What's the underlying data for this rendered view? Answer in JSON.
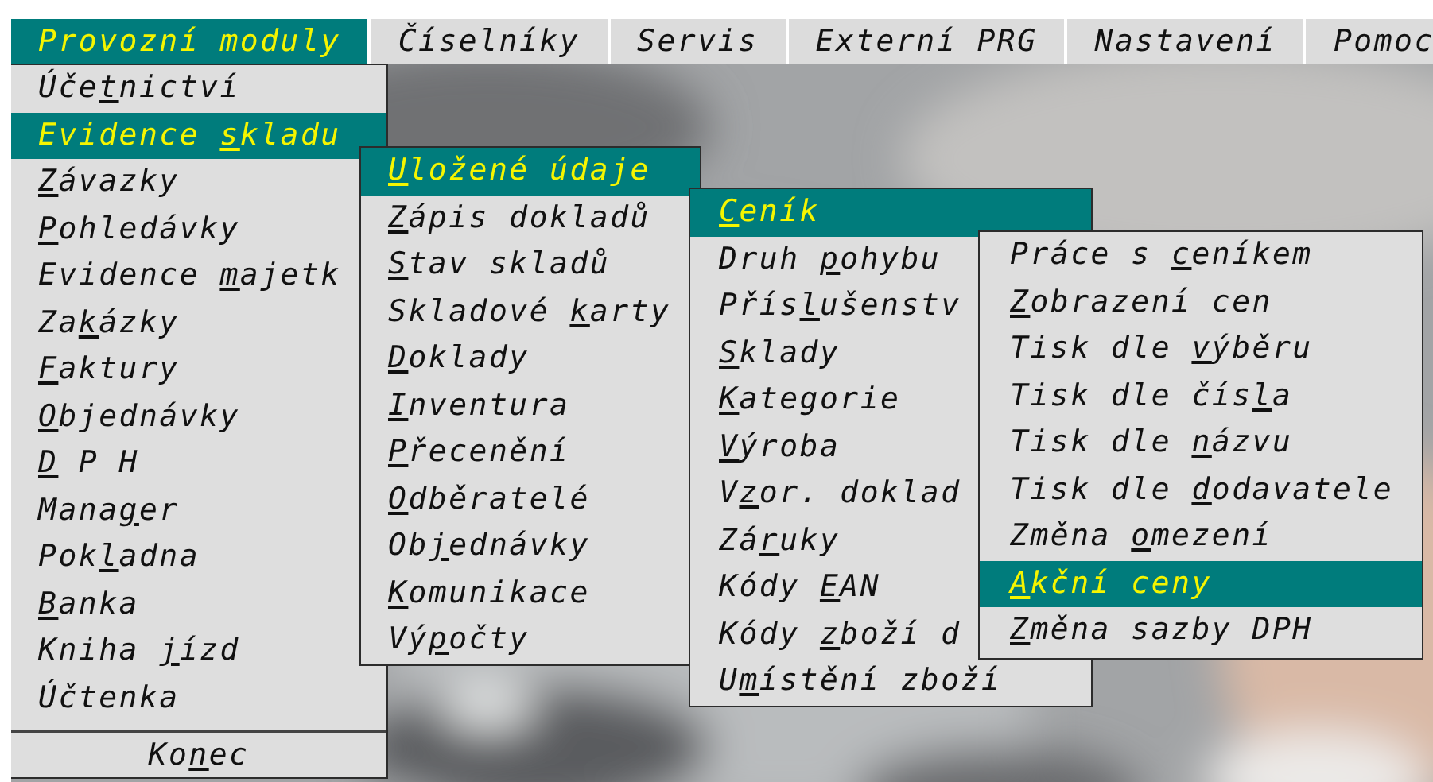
{
  "menubar": [
    {
      "label": "Provozní moduly",
      "selected": true
    },
    {
      "label": "Číselníky",
      "selected": false
    },
    {
      "label": "Servis",
      "selected": false
    },
    {
      "label": "Externí PRG",
      "selected": false
    },
    {
      "label": "Nastavení",
      "selected": false
    },
    {
      "label": "Pomoc",
      "selected": false
    }
  ],
  "menus": [
    {
      "items": [
        {
          "before": "Úče",
          "hotkey": "t",
          "after": "nictví",
          "selected": false
        },
        {
          "before": "Evidence ",
          "hotkey": "s",
          "after": "kladu",
          "selected": true
        },
        {
          "hotkey": "Z",
          "after": "ávazky",
          "selected": false
        },
        {
          "hotkey": "P",
          "after": "ohledávky",
          "selected": false
        },
        {
          "before": "Evidence ",
          "hotkey": "m",
          "after": "ajetk",
          "selected": false
        },
        {
          "before": "Za",
          "hotkey": "k",
          "after": "ázky",
          "selected": false
        },
        {
          "hotkey": "F",
          "after": "aktury",
          "selected": false
        },
        {
          "hotkey": "O",
          "after": "bjednávky",
          "selected": false
        },
        {
          "hotkey": "D",
          "after": " P H",
          "selected": false
        },
        {
          "before": "Mana",
          "hotkey": "g",
          "after": "er",
          "selected": false
        },
        {
          "before": "Pok",
          "hotkey": "l",
          "after": "adna",
          "selected": false
        },
        {
          "hotkey": "B",
          "after": "anka",
          "selected": false
        },
        {
          "before": "Kniha ",
          "hotkey": "j",
          "after": "ízd",
          "selected": false
        },
        {
          "before": "Účtenka",
          "selected": false
        }
      ],
      "footer": {
        "before": "Ko",
        "hotkey": "n",
        "after": "ec"
      }
    },
    {
      "items": [
        {
          "hotkey": "U",
          "after": "ložené údaje",
          "selected": true
        },
        {
          "hotkey": "Z",
          "after": "ápis dokladů",
          "selected": false
        },
        {
          "hotkey": "S",
          "after": "tav skladů",
          "selected": false
        },
        {
          "before": "Skladové ",
          "hotkey": "k",
          "after": "arty",
          "selected": false
        },
        {
          "hotkey": "D",
          "after": "oklady",
          "selected": false
        },
        {
          "hotkey": "I",
          "after": "nventura",
          "selected": false
        },
        {
          "hotkey": "P",
          "after": "řecenění",
          "selected": false
        },
        {
          "hotkey": "O",
          "after": "dběratelé",
          "selected": false
        },
        {
          "before": "Ob",
          "hotkey": "j",
          "after": "ednávky",
          "selected": false
        },
        {
          "hotkey": "K",
          "after": "omunikace",
          "selected": false
        },
        {
          "before": "Vý",
          "hotkey": "p",
          "after": "očty",
          "selected": false
        }
      ]
    },
    {
      "items": [
        {
          "hotkey": "C",
          "after": "eník",
          "selected": true
        },
        {
          "before": "Druh ",
          "hotkey": "p",
          "after": "ohybu",
          "selected": false
        },
        {
          "before": "Přís",
          "hotkey": "l",
          "after": "ušenstv",
          "selected": false
        },
        {
          "hotkey": "S",
          "after": "klady",
          "selected": false
        },
        {
          "hotkey": "K",
          "after": "ategorie",
          "selected": false
        },
        {
          "hotkey": "V",
          "after": "ýroba",
          "selected": false
        },
        {
          "before": "V",
          "hotkey": "z",
          "after": "or. doklad",
          "selected": false
        },
        {
          "before": "Zá",
          "hotkey": "r",
          "after": "uky",
          "selected": false
        },
        {
          "before": "Kódy ",
          "hotkey": "E",
          "after": "AN",
          "selected": false
        },
        {
          "before": "Kódy ",
          "hotkey": "z",
          "after": "boží d",
          "selected": false
        },
        {
          "before": "U",
          "hotkey": "m",
          "after": "ístění zboží",
          "selected": false
        }
      ]
    },
    {
      "items": [
        {
          "before": "Práce s ",
          "hotkey": "c",
          "after": "eníkem",
          "selected": false
        },
        {
          "hotkey": "Z",
          "after": "obrazení cen",
          "selected": false
        },
        {
          "before": "Tisk dle ",
          "hotkey": "v",
          "after": "ýběru",
          "selected": false
        },
        {
          "before": "Tisk dle čís",
          "hotkey": "l",
          "after": "a",
          "selected": false
        },
        {
          "before": "Tisk dle ",
          "hotkey": "n",
          "after": "ázvu",
          "selected": false
        },
        {
          "before": "Tisk dle ",
          "hotkey": "d",
          "after": "odavatele",
          "selected": false
        },
        {
          "before": "Změna ",
          "hotkey": "o",
          "after": "mezení",
          "selected": false
        },
        {
          "hotkey": "A",
          "after": "kční ceny",
          "selected": true
        },
        {
          "hotkey": "Z",
          "after": "měna sazby DPH",
          "selected": false
        }
      ]
    }
  ]
}
